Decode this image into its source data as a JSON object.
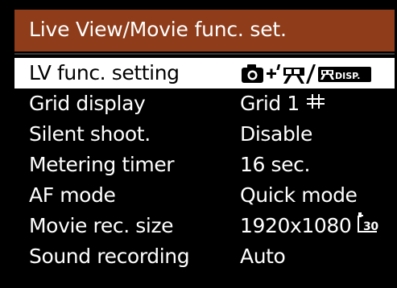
{
  "menu": {
    "title": "Live View/Movie func. set.",
    "items": [
      {
        "label": "LV func. setting",
        "value": "",
        "value_icon": "camera-plus-movie-display-icon",
        "selected": true
      },
      {
        "label": "Grid display",
        "value": "Grid 1",
        "value_icon": "grid-icon",
        "selected": false
      },
      {
        "label": "Silent shoot.",
        "value": "Disable",
        "selected": false
      },
      {
        "label": "Metering timer",
        "value": "16 sec.",
        "selected": false
      },
      {
        "label": "AF mode",
        "value": "Quick mode",
        "selected": false
      },
      {
        "label": "Movie rec. size",
        "value": "1920x1080",
        "value_icon": "frame-rate-30-icon",
        "selected": false
      },
      {
        "label": "Sound recording",
        "value": "Auto",
        "selected": false
      }
    ]
  },
  "colors": {
    "title_bar": "#8e3c1a",
    "background": "#000000",
    "selected_bg": "#ffffff",
    "text": "#ffffff",
    "selected_text": "#000000"
  },
  "icons": {
    "lv_setting_disp_text": "DISP.",
    "frame_rate": "30"
  }
}
